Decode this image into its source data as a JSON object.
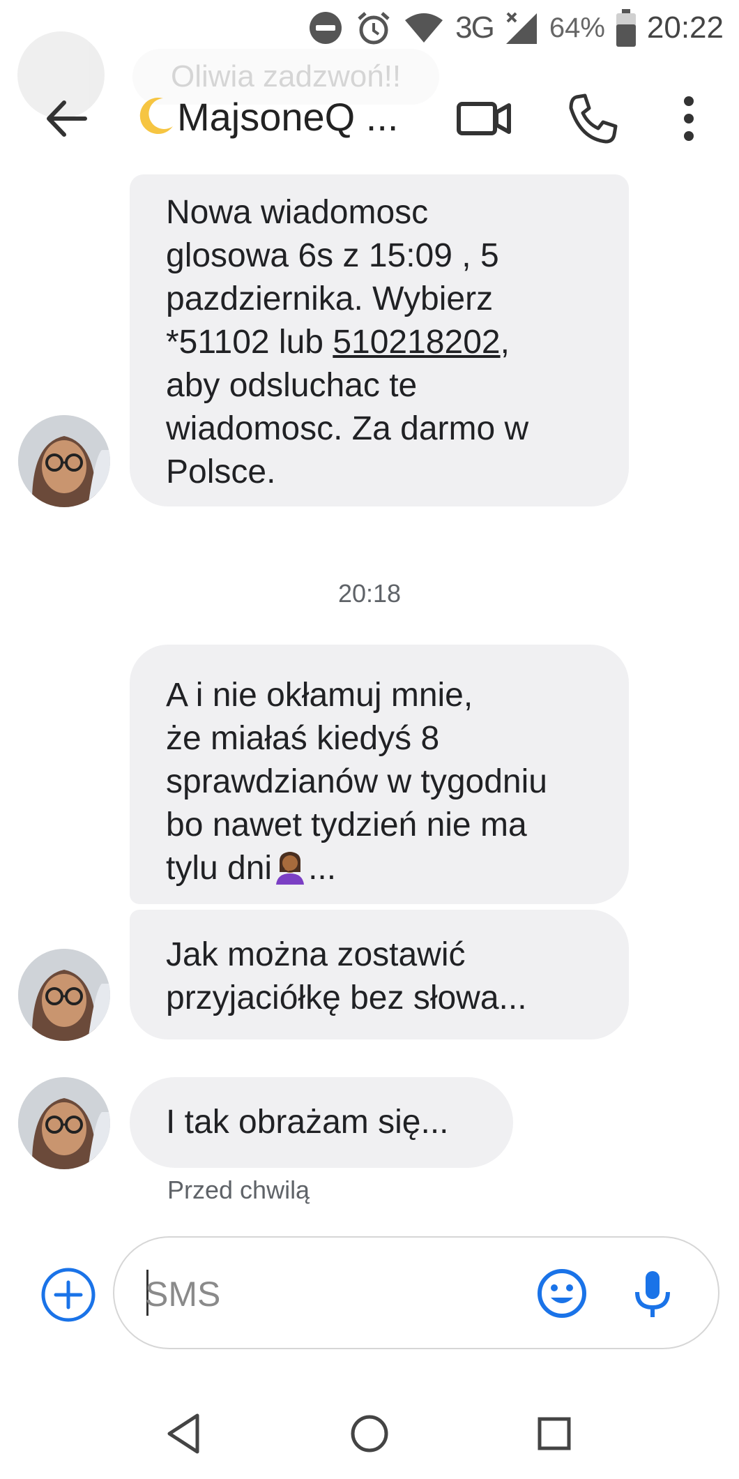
{
  "status_bar": {
    "network": "3G",
    "battery": "64%",
    "time": "20:22",
    "icons": [
      "do-not-disturb-icon",
      "alarm-icon",
      "wifi-icon",
      "signal-icon",
      "battery-icon"
    ]
  },
  "notification": {
    "text": "Oliwia zadzwoń!!"
  },
  "header": {
    "title": "MajsoneQ ...",
    "title_emoji": "crescent-moon-icon",
    "actions": [
      "video-call-icon",
      "phone-icon",
      "more-vert-icon"
    ]
  },
  "messages": {
    "m1": {
      "before": "Nowa wiadomosc\nglosowa 6s z 15:09 , 5\npazdziernika.  Wybierz\n*51102 lub ",
      "link": "510218202",
      "after": ",\naby odsluchac te\nwiadomosc. Za darmo w\nPolsce."
    },
    "time_divider": "20:18",
    "m2": "A i nie okłamuj mnie,\nże miałaś kiedyś 8\nsprawdzianów w tygodniu\nbo nawet tydzień nie ma\ntylu dni",
    "m2_tail": "...",
    "m2_emoji": "facepalm-emoji",
    "m3": "Jak można zostawić\nprzyjaciółkę bez słowa...",
    "m4": "I tak obrażam się...",
    "status": "Przed chwilą"
  },
  "compose": {
    "placeholder": "SMS"
  },
  "colors": {
    "accent": "#1a73e8",
    "bubble": "#f0f0f2",
    "text": "#202124",
    "secondary": "#5f6368"
  },
  "nav_bar": [
    "back-triangle-icon",
    "home-circle-icon",
    "recents-square-icon"
  ]
}
